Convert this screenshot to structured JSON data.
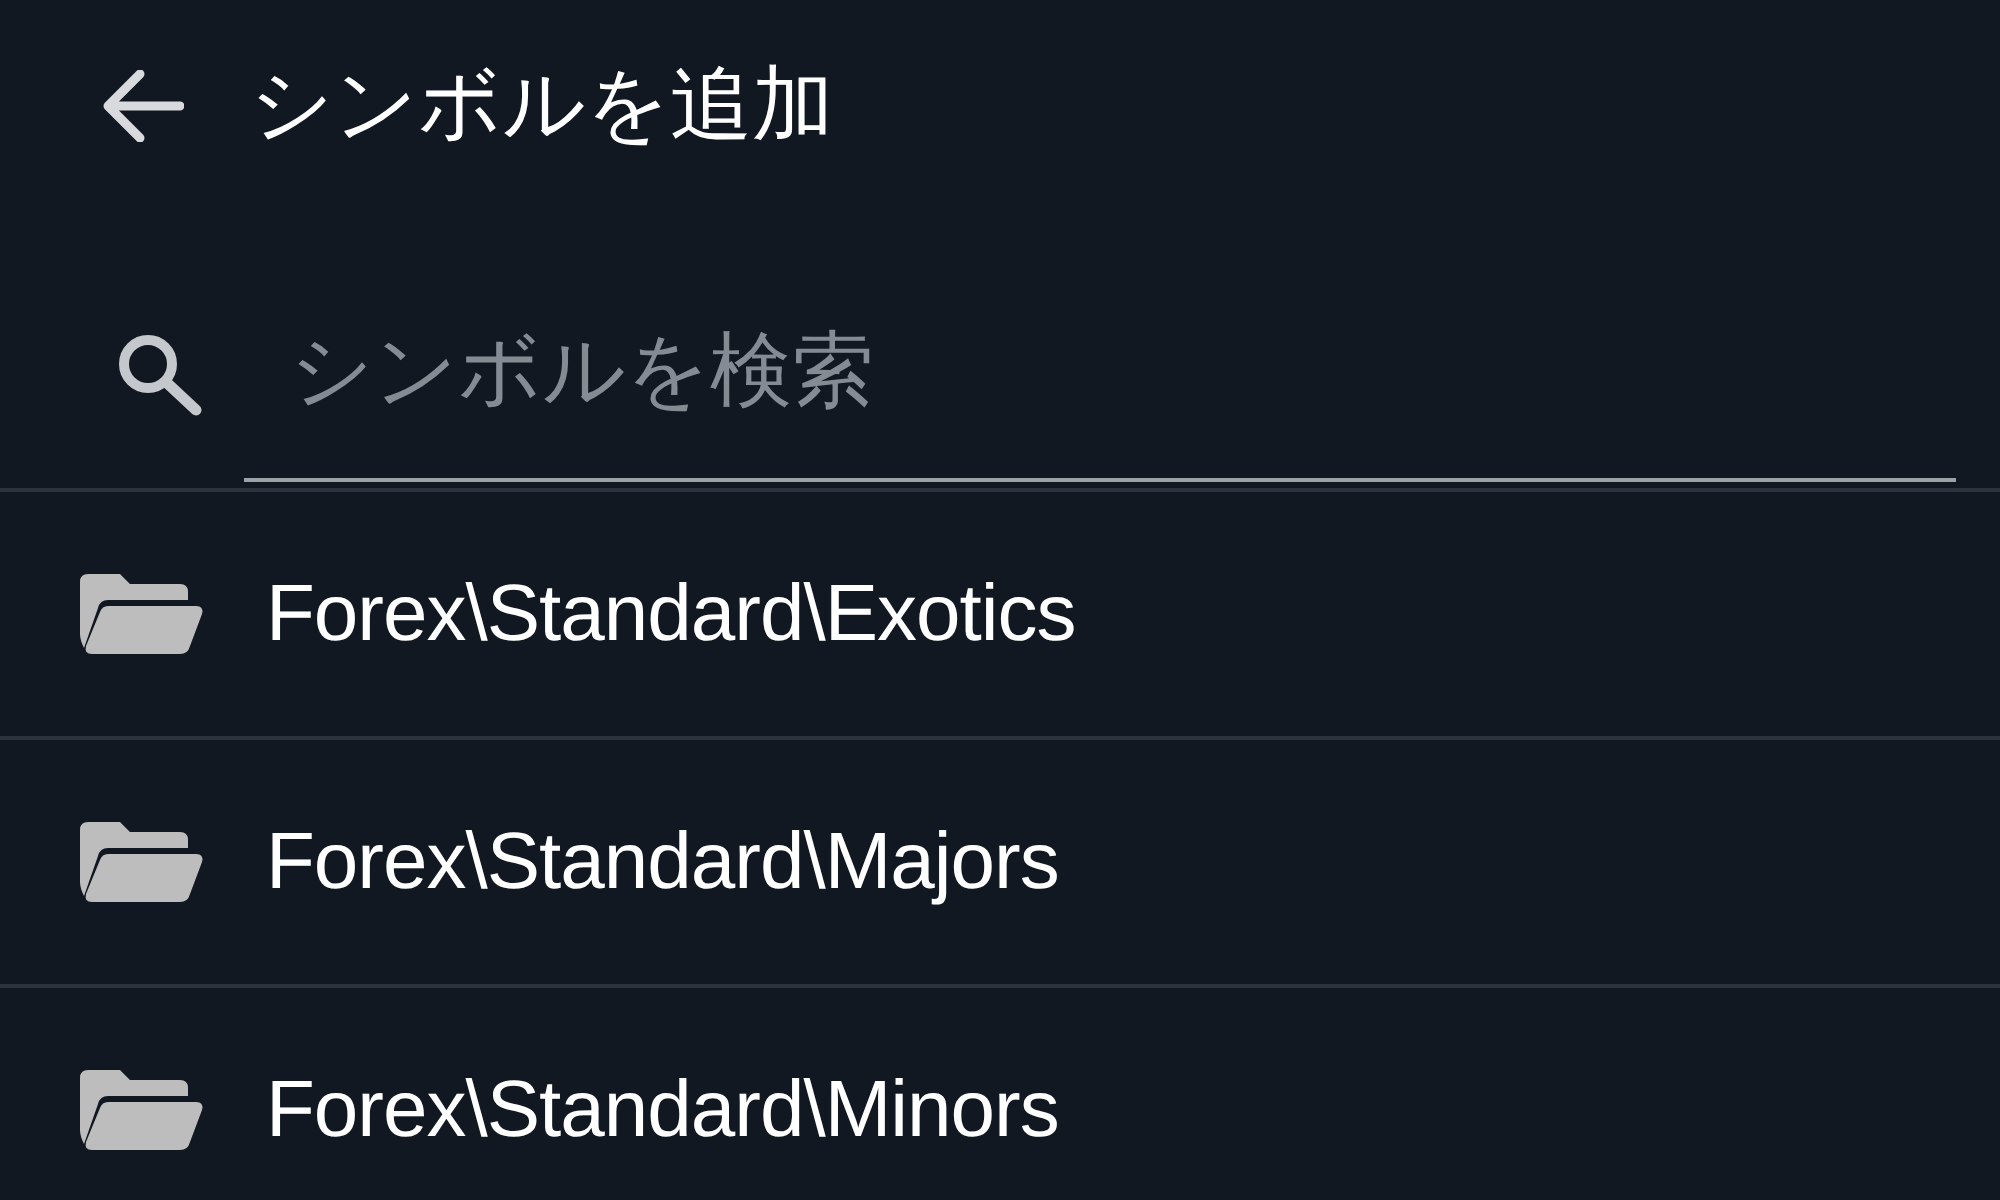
{
  "header": {
    "title": "シンボルを追加"
  },
  "search": {
    "placeholder": "シンボルを検索"
  },
  "folders": [
    {
      "label": "Forex\\Standard\\Exotics"
    },
    {
      "label": "Forex\\Standard\\Majors"
    },
    {
      "label": "Forex\\Standard\\Minors"
    }
  ]
}
